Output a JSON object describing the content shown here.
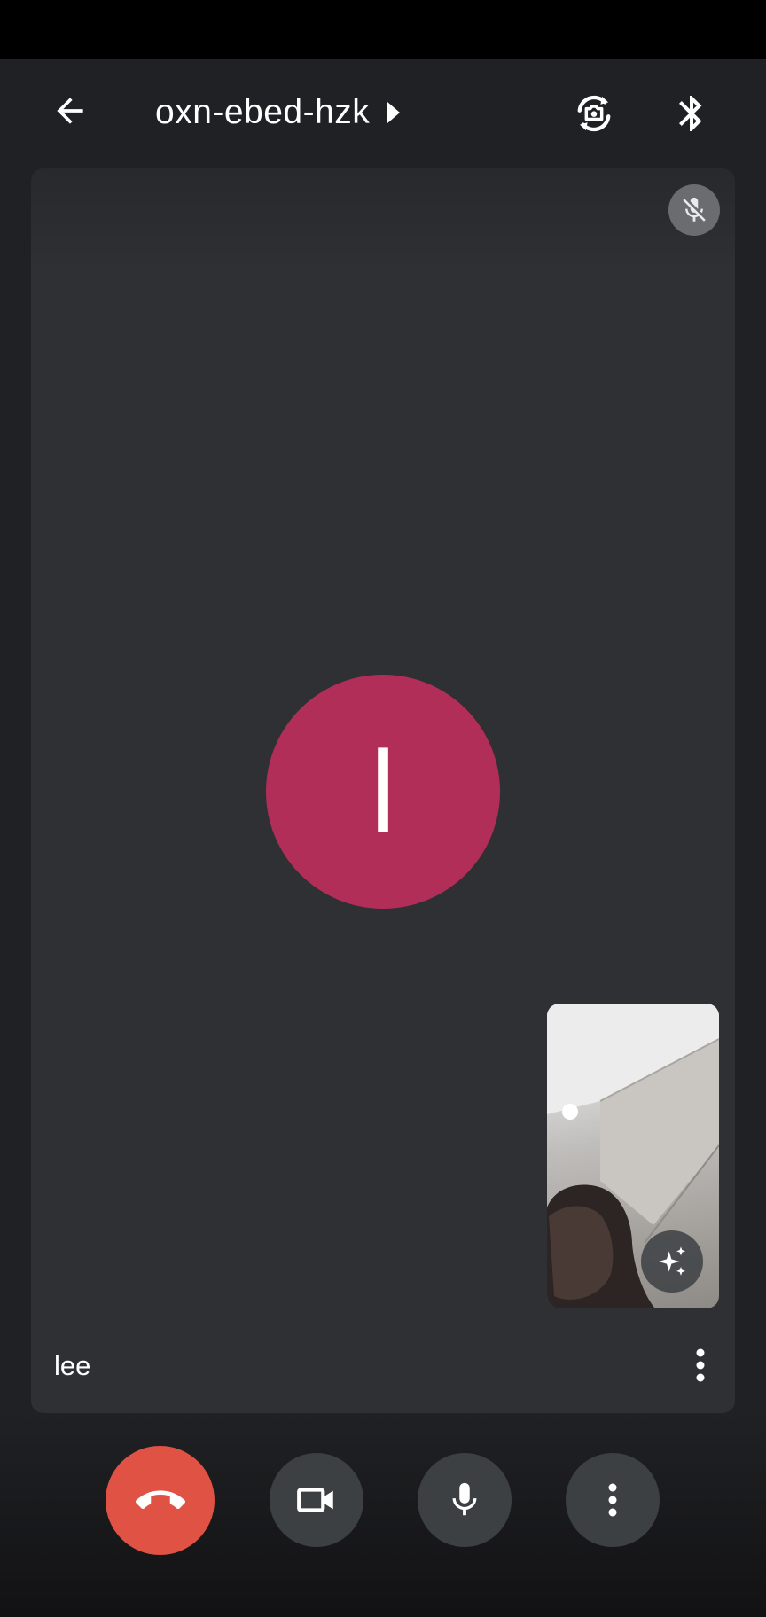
{
  "meeting": {
    "code": "oxn-ebed-hzk"
  },
  "participant": {
    "initial": "l",
    "name": "lee",
    "avatar_color": "#b12e58"
  },
  "icons": {
    "back": "arrow-back-icon",
    "title_caret": "caret-right-icon",
    "switch_camera": "switch-camera-icon",
    "bluetooth": "bluetooth-icon",
    "participant_muted": "mic-off-icon",
    "effects": "sparkle-effects-icon",
    "tile_more": "more-vert-icon",
    "end_call": "call-end-icon",
    "camera": "videocam-icon",
    "microphone": "mic-icon",
    "more_options": "more-vert-icon"
  },
  "colors": {
    "end_call": "#e05243",
    "control_bg": "#3c4043",
    "tile_bg": "#2e3034"
  }
}
